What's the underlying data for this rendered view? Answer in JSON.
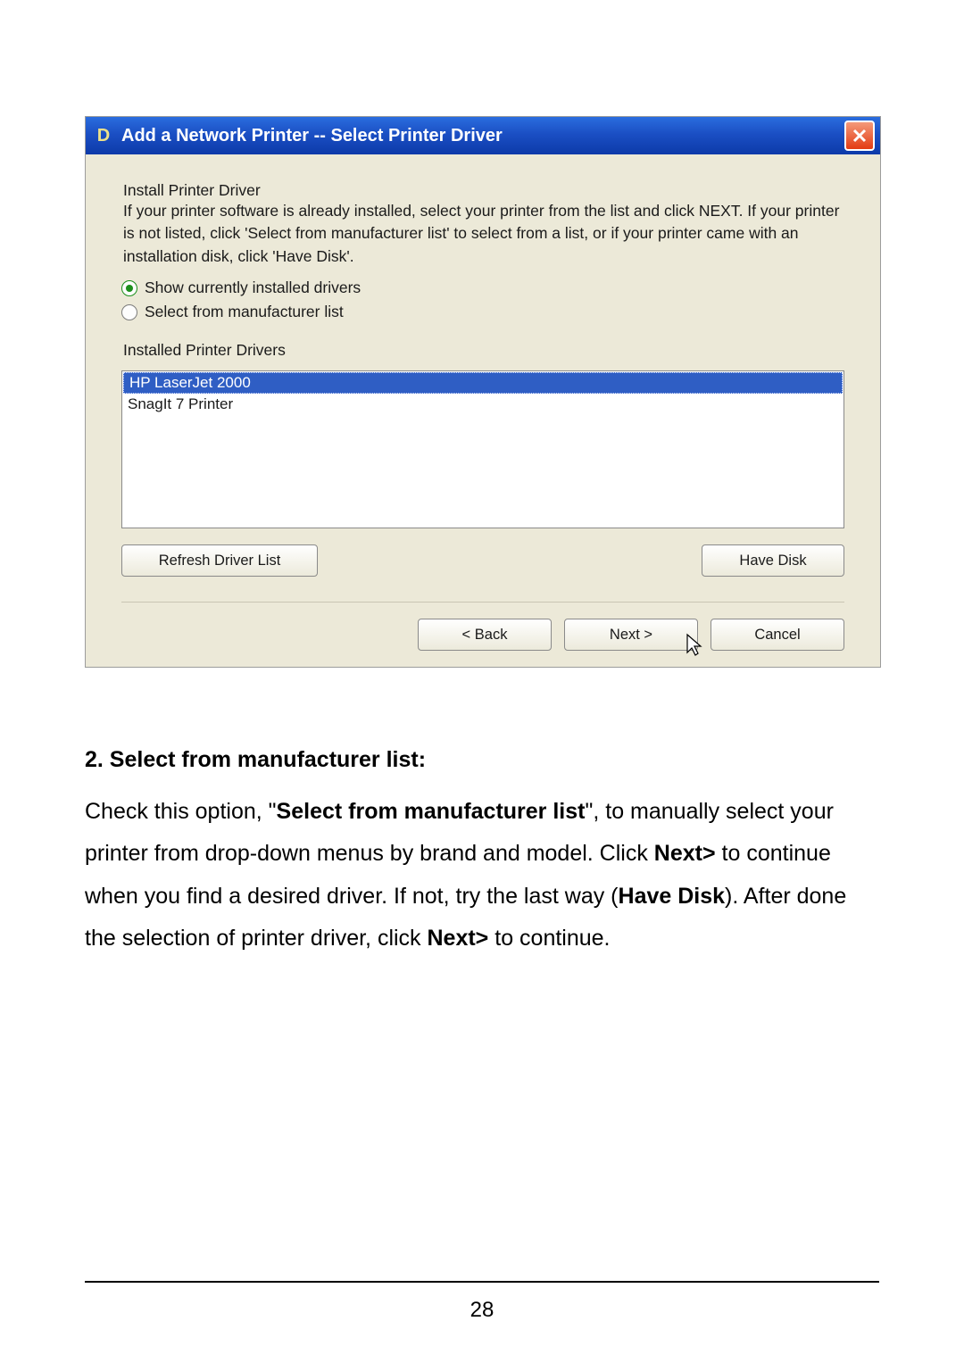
{
  "dialog": {
    "title": "Add a Network Printer  --  Select Printer Driver",
    "heading": "Install Printer Driver",
    "description": "If your printer software is already installed, select your printer from the list and click NEXT. If your printer is not listed, click 'Select from manufacturer list' to select from a list, or if your printer came with an installation disk, click 'Have Disk'.",
    "radio1": "Show currently installed drivers",
    "radio2": "Select from manufacturer list",
    "list_label": "Installed Printer Drivers",
    "drivers": [
      "HP LaserJet 2000",
      "SnagIt 7 Printer"
    ],
    "refresh": "Refresh Driver List",
    "have_disk": "Have Disk",
    "back": "< Back",
    "next": "Next >",
    "cancel": "Cancel"
  },
  "instructions": {
    "heading": "2. Select from manufacturer list:",
    "p1a": "Check this option, \"",
    "p1b": "Select from manufacturer list",
    "p1c": "\", to manually select your printer from drop-down menus by brand and model. Click ",
    "p1d": "Next>",
    "p1e": " to continue when you find a desired driver. If not, try the last way (",
    "p1f": "Have Disk",
    "p1g": "). After done the selection of printer driver, click ",
    "p1h": "Next>",
    "p1i": " to continue."
  },
  "page_number": "28"
}
